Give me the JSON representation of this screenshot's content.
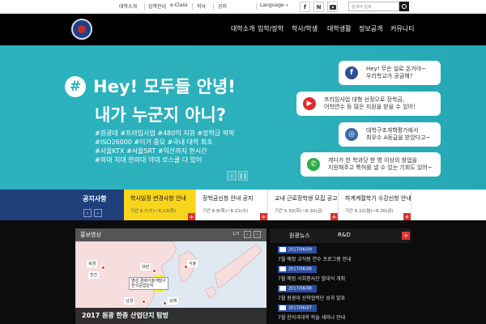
{
  "topbar": {
    "links": [
      "대학소개",
      "입학안내",
      "e-Class",
      "학사",
      "공지"
    ],
    "language": "Language",
    "social_icons": [
      "facebook-icon",
      "blog-icon",
      "youtube-icon"
    ],
    "search_placeholder": "검색어 입력"
  },
  "nav": {
    "menus": [
      "대학소개",
      "입학/장학",
      "학사/학생",
      "대학생활",
      "정보공개",
      "커뮤니티"
    ]
  },
  "hero": {
    "line1": "Hey! 모두들 안녕!",
    "line2": "내가 누군지 아니?",
    "tags": [
      "#원광대 #프라임사업 #480억 지원 #장학금 팍팍",
      "#ISO26000 #이거 중요 #국내 대학 최초",
      "#서울KTX #서울SRT #익산까지 한시간",
      "#의대 치대 한의대 약대 로스쿨 다 있어"
    ],
    "bubbles": [
      {
        "icon": "facebook-icon",
        "color": "#2f4f95",
        "lines": [
          "Hey! 무슨 일로 온거야~",
          "우리학교가 궁금해?"
        ]
      },
      {
        "icon": "youtube-icon",
        "color": "#e02b2b",
        "lines": [
          "프라임사업 대형 선정으로 장학금,",
          "어학연수 등 많은 지원을 받을 수 있어!"
        ]
      },
      {
        "icon": "instagram-icon",
        "color": "#3b6aa8",
        "lines": [
          "대학구조개혁평가에서",
          "최우수 A등급을 받았다고~"
        ]
      },
      {
        "icon": "kakao-icon",
        "color": "#2eaa4a",
        "lines": [
          "게다가 한 학과당 한 명 이상의 창업을",
          "지원해주고 특허를 낼 수 있는 기회도 있어~"
        ]
      }
    ],
    "pager_prev": "‹",
    "pager_pause": "❙❙"
  },
  "notice": {
    "title": "공지사항",
    "arrow_prev": "‹",
    "arrow_next": "›",
    "items": [
      {
        "title": "학사일정 변경사항 안내",
        "date": "기간 6.7(수)~6.13(화)",
        "active": true
      },
      {
        "title": "장학금신청 안내 공지",
        "date": "기간 6.8(목)~6.21(수)",
        "active": false
      },
      {
        "title": "교내 근로장학생 모집 공고",
        "date": "기간 5.30(화)~6.30(금)",
        "active": false
      },
      {
        "title": "하계계절학기 수강신청 안내",
        "date": "기간 6.12(월)~6.30(금)",
        "active": false
      }
    ]
  },
  "map": {
    "label": "홍보영상",
    "counter": "1/3",
    "prev": "‹",
    "next": "›",
    "cities": [
      "북경",
      "천진",
      "대련",
      "서울",
      "남경",
      "상해"
    ],
    "callout": [
      "영성 경제기술개발구",
      "한국공업단지"
    ],
    "caption": "2017 원광 한중 산업단지 탐방"
  },
  "news": {
    "tabs": [
      "원광뉴스",
      "R&D"
    ],
    "plus": "+",
    "items": [
      {
        "date": "2017/06/09",
        "text": "7월 예정 교직원 연수 프로그램 안내"
      },
      {
        "date": "2017/06/08",
        "text": "7월 예정 사회봉사단 발대식 개최"
      },
      {
        "date": "2017/06/08",
        "text": "7월 원광대 산학협력단 성과 발표"
      },
      {
        "date": "2017/06/07",
        "text": "7월 한의과대학 학술 세미나 안내"
      },
      {
        "date": "2017/06/07",
        "text": "7월 도서관 리모델링 완료 소식"
      }
    ]
  }
}
